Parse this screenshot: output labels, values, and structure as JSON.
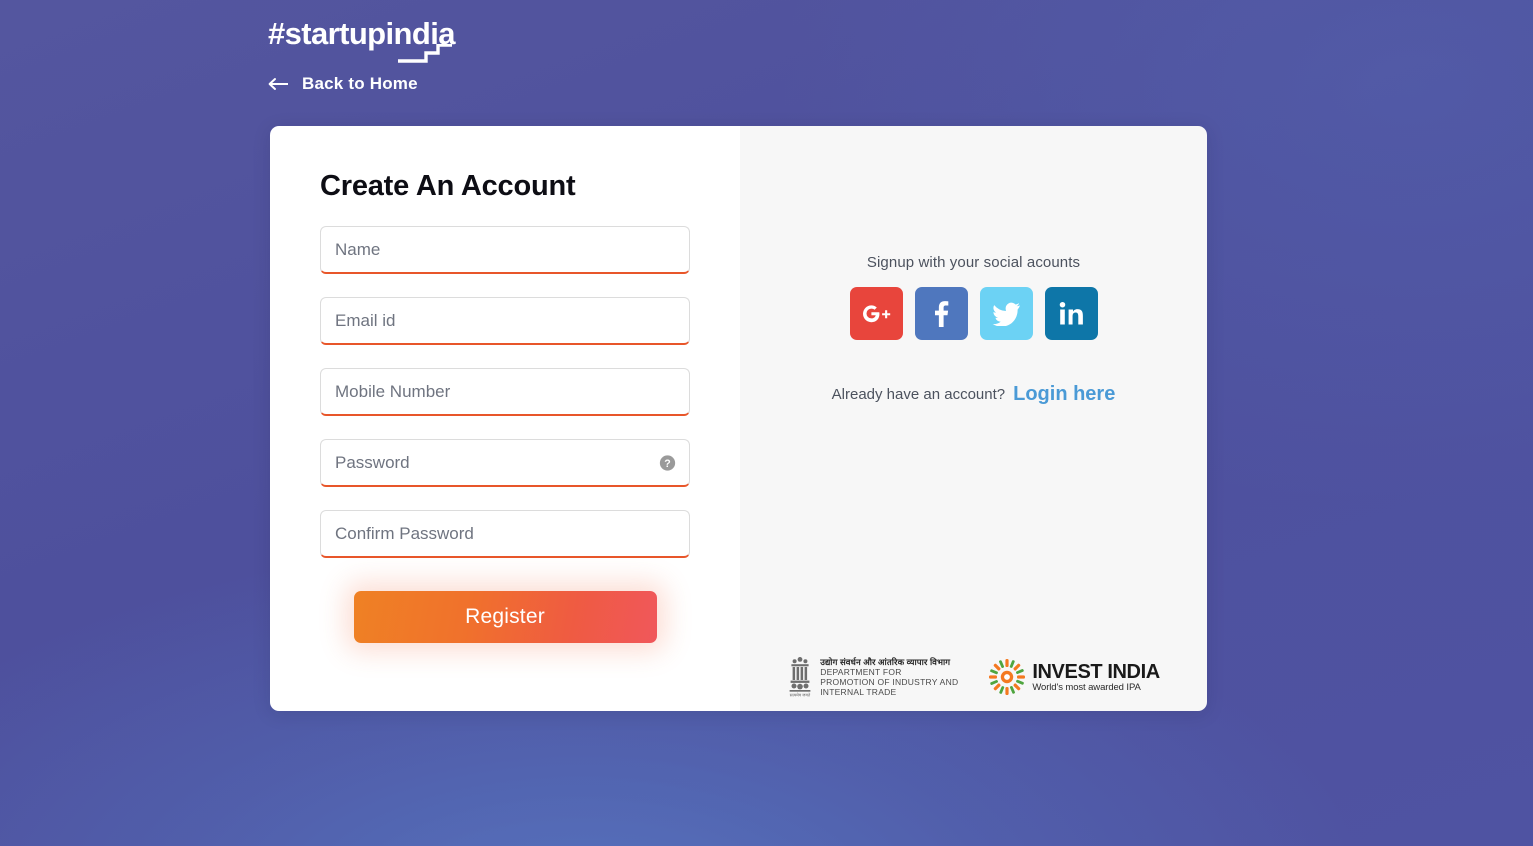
{
  "header": {
    "logo_text": "#startupindia",
    "logo_icon": "startupindia-step-mark",
    "back_link": {
      "label": "Back to Home",
      "icon": "arrow-left-icon"
    }
  },
  "card": {
    "form": {
      "title": "Create An Account",
      "fields": [
        {
          "name": "name",
          "placeholder": "Name",
          "value": "",
          "type": "text"
        },
        {
          "name": "email",
          "placeholder": "Email id",
          "value": "",
          "type": "text"
        },
        {
          "name": "mobile",
          "placeholder": "Mobile Number",
          "value": "",
          "type": "text"
        },
        {
          "name": "password",
          "placeholder": "Password",
          "value": "",
          "type": "password",
          "help_icon": "question-mark-circle-icon"
        },
        {
          "name": "confirm_password",
          "placeholder": "Confirm Password",
          "value": "",
          "type": "password"
        }
      ],
      "submit_label": "Register"
    },
    "social": {
      "caption": "Signup with your social acounts",
      "accounts": [
        {
          "name": "google-plus",
          "glyph": "G+",
          "color": "#e8453c"
        },
        {
          "name": "facebook",
          "glyph": "f",
          "color": "#4f77be"
        },
        {
          "name": "twitter",
          "glyph": "bird",
          "color": "#6cd2f4"
        },
        {
          "name": "linkedin",
          "glyph": "in",
          "color": "#0e76a8"
        }
      ]
    },
    "login": {
      "prompt": "Already have an account?",
      "link_label": "Login here"
    },
    "footer": {
      "dpiit": {
        "emblem_icon": "ashoka-emblem-icon",
        "hindi": "उद्योग संवर्धन और आंतरिक व्यापार विभाग",
        "line1": "DEPARTMENT FOR",
        "line2": "PROMOTION OF INDUSTRY AND",
        "line3": "INTERNAL TRADE"
      },
      "invest_india": {
        "logo_icon": "invest-india-pinwheel-icon",
        "name": "INVEST INDIA",
        "tagline": "World's most awarded IPA"
      }
    }
  },
  "colors": {
    "background": "#50529f",
    "accent_orange": "#e8562a",
    "button_gradient_start": "#ef8124",
    "button_gradient_end": "#f0575b",
    "link_blue": "#4a9ad6"
  }
}
